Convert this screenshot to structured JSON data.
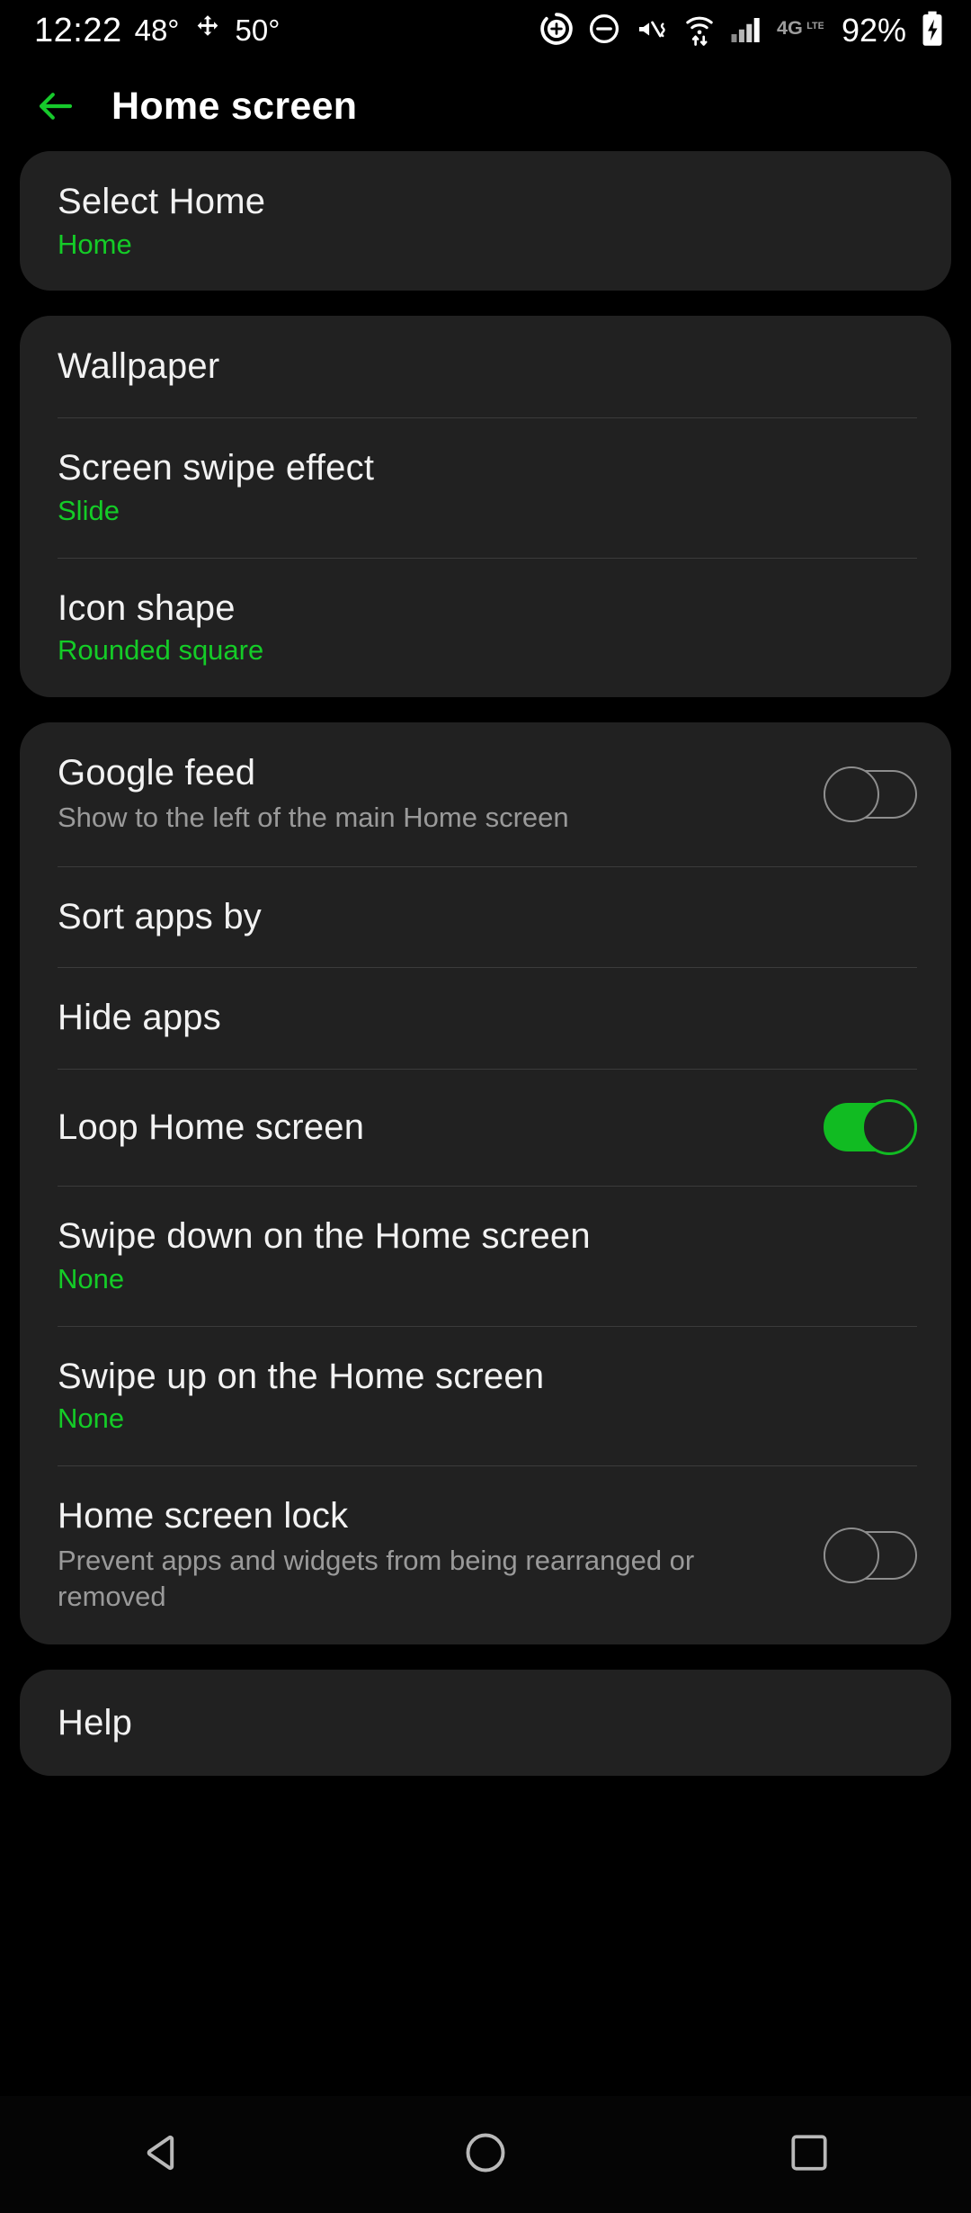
{
  "status_bar": {
    "clock": "12:22",
    "temperature_outdoor": "48°",
    "temperature_indoor": "50°",
    "battery_percent": "92%",
    "network_type": "4G LTE",
    "icons": [
      "location-icon",
      "do-not-disturb-icon",
      "mute-vibrate-icon",
      "wifi-icon",
      "signal-bars-icon",
      "lte-icon",
      "battery-charging-icon"
    ]
  },
  "header": {
    "back_label": "back-arrow",
    "title": "Home screen"
  },
  "cards": [
    {
      "rows": [
        {
          "title": "Select Home",
          "value": "Home"
        }
      ]
    },
    {
      "rows": [
        {
          "title": "Wallpaper"
        },
        {
          "title": "Screen swipe effect",
          "value": "Slide"
        },
        {
          "title": "Icon shape",
          "value": "Rounded square"
        }
      ]
    },
    {
      "rows": [
        {
          "title": "Google feed",
          "subtitle": "Show to the left of the main Home screen",
          "toggle": "off"
        },
        {
          "title": "Sort apps by"
        },
        {
          "title": "Hide apps"
        },
        {
          "title": "Loop Home screen",
          "toggle": "on"
        },
        {
          "title": "Swipe down on the Home screen",
          "value": "None"
        },
        {
          "title": "Swipe up on the Home screen",
          "value": "None"
        },
        {
          "title": "Home screen lock",
          "subtitle": "Prevent apps and widgets from being rearranged or removed",
          "toggle": "off"
        }
      ]
    },
    {
      "rows": [
        {
          "title": "Help"
        }
      ]
    }
  ],
  "navigation_bar": {
    "back": "back-triangle-icon",
    "home": "home-circle-icon",
    "recents": "recents-square-icon"
  },
  "colors": {
    "accent_green": "#14cc27",
    "toggle_on_green": "#11bb22",
    "card_background": "#212121",
    "page_background": "#000000",
    "subtitle_gray": "#9a9a9a"
  }
}
